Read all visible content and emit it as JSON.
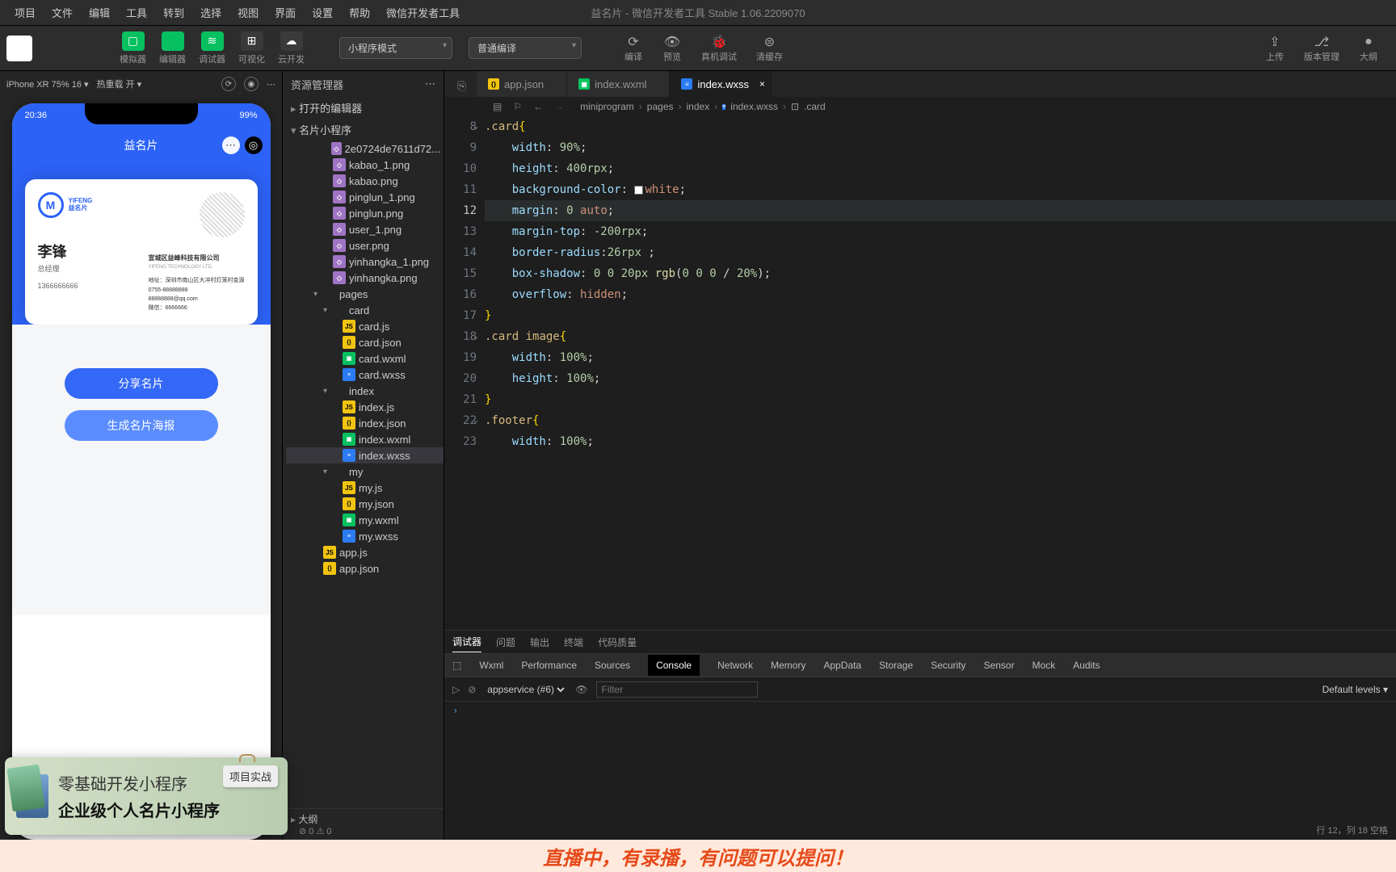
{
  "window": {
    "title": "益名片 - 微信开发者工具 Stable 1.06.2209070"
  },
  "menu": [
    "项目",
    "文件",
    "编辑",
    "工具",
    "转到",
    "选择",
    "视图",
    "界面",
    "设置",
    "帮助",
    "微信开发者工具"
  ],
  "toolbar": {
    "buttons": [
      {
        "icon": "▢",
        "label": "模拟器",
        "green": true
      },
      {
        "icon": "</>",
        "label": "编辑器",
        "green": true
      },
      {
        "icon": "≋",
        "label": "调试器",
        "green": true
      },
      {
        "icon": "⊞",
        "label": "可视化",
        "green": false
      },
      {
        "icon": "☁",
        "label": "云开发",
        "green": false
      }
    ],
    "mode_dropdown": "小程序模式",
    "compile_dropdown": "普通编译",
    "center": [
      {
        "icon": "⟳",
        "label": "编译"
      },
      {
        "icon": "👁",
        "label": "预览"
      },
      {
        "icon": "🐞",
        "label": "真机调试"
      },
      {
        "icon": "⊜",
        "label": "清缓存"
      }
    ],
    "right": [
      {
        "icon": "⇪",
        "label": "上传"
      },
      {
        "icon": "⎇",
        "label": "版本管理"
      },
      {
        "icon": "●",
        "label": "大纲"
      }
    ]
  },
  "sim": {
    "device": "iPhone XR 75% 16 ▾",
    "hot": "热重载 开 ▾",
    "phone": {
      "time": "20:36",
      "battery": "99%",
      "title": "益名片",
      "card": {
        "brand": "YIFENG",
        "brand_cn": "益名片",
        "name": "李锋",
        "title": "总经理",
        "phone": "1366666666",
        "company": "宣城区益峰科技有限公司",
        "company_en": "YIFENG TECHNOLOGY LTD.",
        "addr": "地址：深圳市南山区大冲村灯笼村金源",
        "tel": "0755-88888888",
        "mail": "88888888@qq.com",
        "web": "微信：6666666"
      },
      "btn_share": "分享名片",
      "btn_poster": "生成名片海报"
    }
  },
  "explorer": {
    "title": "资源管理器",
    "sections": {
      "editors": "打开的编辑器",
      "project": "名片小程序"
    },
    "files": [
      {
        "depth": 3,
        "icon": "png",
        "name": "2e0724de7611d72..."
      },
      {
        "depth": 3,
        "icon": "png",
        "name": "kabao_1.png"
      },
      {
        "depth": 3,
        "icon": "png",
        "name": "kabao.png"
      },
      {
        "depth": 3,
        "icon": "png",
        "name": "pinglun_1.png"
      },
      {
        "depth": 3,
        "icon": "png",
        "name": "pinglun.png"
      },
      {
        "depth": 3,
        "icon": "png",
        "name": "user_1.png"
      },
      {
        "depth": 3,
        "icon": "png",
        "name": "user.png"
      },
      {
        "depth": 3,
        "icon": "png",
        "name": "yinhangka_1.png"
      },
      {
        "depth": 3,
        "icon": "png",
        "name": "yinhangka.png"
      },
      {
        "depth": 2,
        "icon": "folder",
        "name": "pages",
        "chev": "▾"
      },
      {
        "depth": 3,
        "icon": "folder",
        "name": "card",
        "chev": "▾"
      },
      {
        "depth": 4,
        "icon": "js",
        "name": "card.js"
      },
      {
        "depth": 4,
        "icon": "json",
        "name": "card.json"
      },
      {
        "depth": 4,
        "icon": "wxml",
        "name": "card.wxml"
      },
      {
        "depth": 4,
        "icon": "wxss",
        "name": "card.wxss"
      },
      {
        "depth": 3,
        "icon": "folder",
        "name": "index",
        "chev": "▾"
      },
      {
        "depth": 4,
        "icon": "js",
        "name": "index.js"
      },
      {
        "depth": 4,
        "icon": "json",
        "name": "index.json"
      },
      {
        "depth": 4,
        "icon": "wxml",
        "name": "index.wxml"
      },
      {
        "depth": 4,
        "icon": "wxss",
        "name": "index.wxss",
        "active": true
      },
      {
        "depth": 3,
        "icon": "folder",
        "name": "my",
        "chev": "▾"
      },
      {
        "depth": 4,
        "icon": "js",
        "name": "my.js"
      },
      {
        "depth": 4,
        "icon": "json",
        "name": "my.json"
      },
      {
        "depth": 4,
        "icon": "wxml",
        "name": "my.wxml"
      },
      {
        "depth": 4,
        "icon": "wxss",
        "name": "my.wxss"
      },
      {
        "depth": 2,
        "icon": "js",
        "name": "app.js"
      },
      {
        "depth": 2,
        "icon": "json",
        "name": "app.json"
      }
    ],
    "outline": "大纲",
    "problems": "⊘ 0  ⚠ 0"
  },
  "tabs": [
    {
      "icon": "json",
      "name": "app.json"
    },
    {
      "icon": "wxml",
      "name": "index.wxml"
    },
    {
      "icon": "wxss",
      "name": "index.wxss",
      "active": true
    }
  ],
  "breadcrumb": [
    "miniprogram",
    "pages",
    "index",
    "index.wxss",
    ".card"
  ],
  "code_start": 8,
  "code_current": 12,
  "debugger": {
    "tabs": [
      "调试器",
      "问题",
      "输出",
      "终端",
      "代码质量"
    ],
    "devtools": [
      "Wxml",
      "Performance",
      "Sources",
      "Console",
      "Network",
      "Memory",
      "AppData",
      "Storage",
      "Security",
      "Sensor",
      "Mock",
      "Audits"
    ],
    "devtools_active": "Console",
    "context": "appservice (#6)",
    "filter_ph": "Filter",
    "levels": "Default levels ▾",
    "prompt": "›"
  },
  "banner": {
    "line1": "零基础开发小程序",
    "line2": "企业级个人名片小程序",
    "tag": "项目实战"
  },
  "scroll": "直播中，有录播，有问题可以提问！",
  "status": "行 12，列 18   空格"
}
